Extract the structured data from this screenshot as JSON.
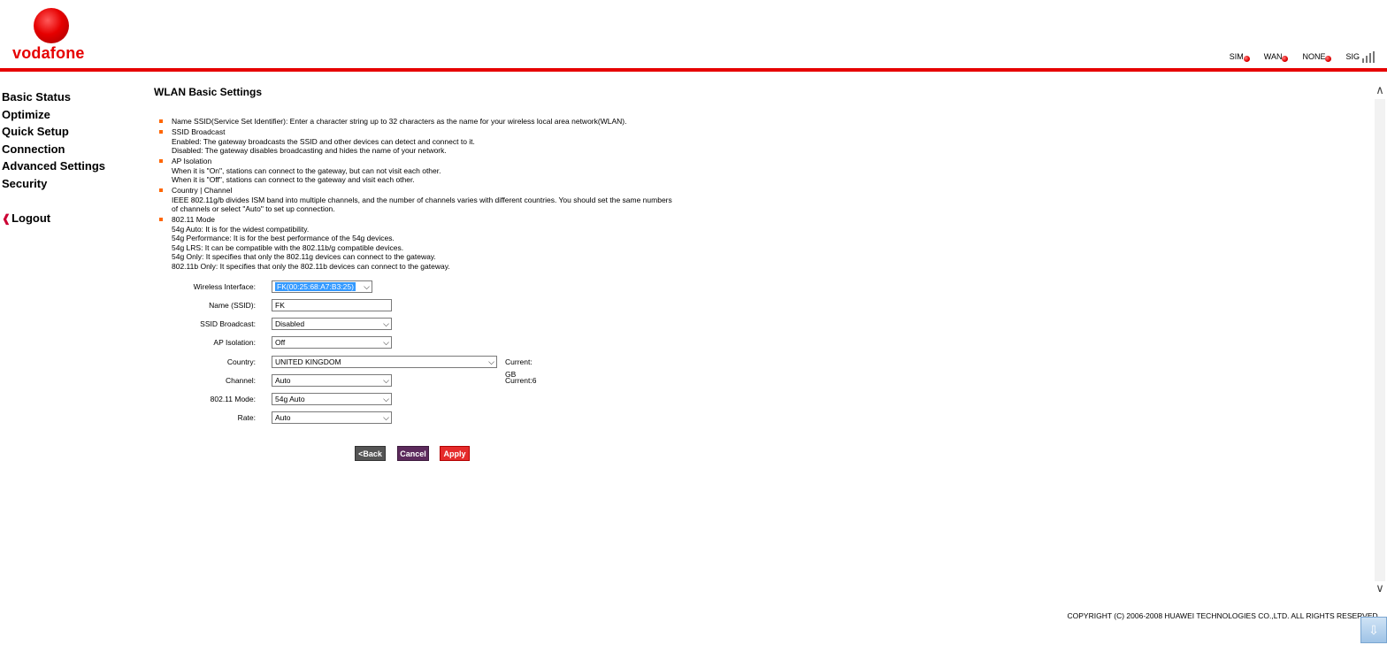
{
  "brand": {
    "name": "vodafone"
  },
  "status": {
    "indicators": [
      {
        "label": "SIM"
      },
      {
        "label": "WAN"
      },
      {
        "label": "NONE"
      }
    ],
    "signal_label": "SIG"
  },
  "sidebar": {
    "items": [
      {
        "label": "Basic Status"
      },
      {
        "label": "Optimize"
      },
      {
        "label": "Quick Setup"
      },
      {
        "label": "Connection"
      },
      {
        "label": "Advanced Settings"
      },
      {
        "label": "Security"
      }
    ],
    "logout": "Logout"
  },
  "page": {
    "title": "WLAN Basic Settings"
  },
  "help": {
    "items": [
      {
        "lines": [
          "Name SSID(Service Set Identifier): Enter a character string up to 32 characters as the name for your wireless local area network(WLAN)."
        ]
      },
      {
        "lines": [
          "SSID Broadcast",
          "Enabled: The gateway broadcasts the SSID and other devices can detect and connect to it.",
          "Disabled: The gateway disables broadcasting and hides the name of your network."
        ]
      },
      {
        "lines": [
          "AP Isolation",
          "When it is \"On\", stations can connect to the gateway, but can not visit each other.",
          "When it is \"Off\", stations can connect to the gateway and visit each other."
        ]
      },
      {
        "lines": [
          "Country | Channel",
          "IEEE 802.11g/b divides ISM band into multiple channels, and the number of channels varies with different countries. You should set the same numbers of channels or select \"Auto\" to set up connection."
        ]
      },
      {
        "lines": [
          "802.11 Mode",
          "54g Auto: It is for the widest compatibility.",
          "54g Performance: It is for the best performance of the 54g devices.",
          "54g LRS: It can be compatible with the 802.11b/g compatible devices.",
          "54g Only: It specifies that only the 802.11g devices can connect to the gateway.",
          "802.11b Only: It specifies that only the 802.11b devices can connect to the gateway."
        ]
      }
    ]
  },
  "form": {
    "wireless_interface": {
      "label": "Wireless Interface:",
      "value": "FK(00:25:68:A7:B3:25)"
    },
    "ssid": {
      "label": "Name (SSID):",
      "value": "FK"
    },
    "ssid_broadcast": {
      "label": "SSID Broadcast:",
      "value": "Disabled"
    },
    "ap_isolation": {
      "label": "AP Isolation:",
      "value": "Off"
    },
    "country": {
      "label": "Country:",
      "value": "UNITED KINGDOM",
      "current": "Current: GB"
    },
    "channel": {
      "label": "Channel:",
      "value": "Auto",
      "current": "Current:6"
    },
    "mode": {
      "label": "802.11 Mode:",
      "value": "54g Auto"
    },
    "rate": {
      "label": "Rate:",
      "value": "Auto"
    }
  },
  "buttons": {
    "back": "<Back",
    "cancel": "Cancel",
    "apply": "Apply"
  },
  "footer": {
    "copyright": "COPYRIGHT (C) 2006-2008 HUAWEI TECHNOLOGIES CO.,LTD. ALL RIGHTS RESERVED."
  },
  "colors": {
    "brand_red": "#e60000",
    "bullet_orange": "#ff6600",
    "apply_red": "#e52b2b",
    "cancel_purple": "#5c2a5c",
    "back_gray": "#555555"
  },
  "icons": {
    "logout": "logout-arrow-icon",
    "signal": "signal-bars-icon",
    "status_dot": "red-dot-icon"
  }
}
